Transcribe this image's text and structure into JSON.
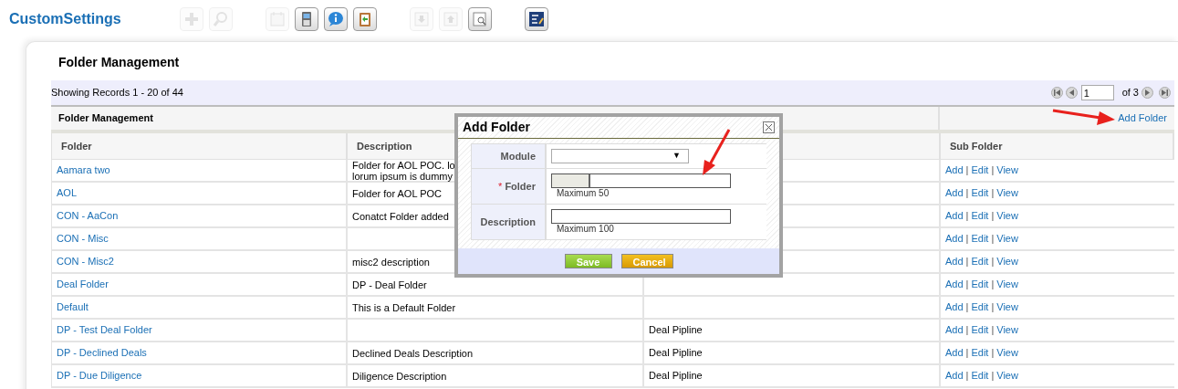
{
  "app_title": "CustomSettings",
  "toolbar": [
    {
      "items": [
        {
          "kind": "plus",
          "disabled": true
        },
        {
          "kind": "search",
          "disabled": true
        }
      ]
    },
    {
      "items": [
        {
          "kind": "calendar",
          "disabled": true
        },
        {
          "kind": "phone",
          "disabled": false
        },
        {
          "kind": "info",
          "disabled": false
        },
        {
          "kind": "clipboard",
          "disabled": false
        }
      ]
    },
    {
      "items": [
        {
          "kind": "down",
          "disabled": true
        },
        {
          "kind": "up",
          "disabled": true
        },
        {
          "kind": "preview",
          "disabled": false
        }
      ]
    },
    {
      "items": [
        {
          "kind": "report",
          "disabled": false
        }
      ]
    }
  ],
  "page_title": "Folder Management",
  "records_info": "Showing Records 1 - 20 of 44",
  "pager": {
    "page": "1",
    "of": "of 3"
  },
  "section": {
    "title": "Folder Management",
    "link": "Add Folder"
  },
  "table": {
    "columns": [
      "Folder",
      "Description",
      "",
      "Sub Folder"
    ],
    "separator": "|",
    "rows": [
      {
        "folder": "Aamara two",
        "description": [
          "Folder for AOL POC. lo",
          "lorum ipsum is dummy"
        ],
        "column_3": "",
        "actions": [
          "Add",
          "Edit",
          "View"
        ]
      },
      {
        "folder": "AOL",
        "description": [
          "Folder for AOL POC"
        ],
        "column_3": "",
        "actions": [
          "Add",
          "Edit",
          "View"
        ]
      },
      {
        "folder": "CON - AaCon",
        "description": [
          "Conatct Folder added"
        ],
        "column_3": "",
        "actions": [
          "Add",
          "Edit",
          "View"
        ]
      },
      {
        "folder": "CON - Misc",
        "description": [],
        "column_3": "",
        "actions": [
          "Add",
          "Edit",
          "View"
        ]
      },
      {
        "folder": "CON - Misc2",
        "description": [
          "misc2 description"
        ],
        "column_3": "",
        "actions": [
          "Add",
          "Edit",
          "View"
        ]
      },
      {
        "folder": "Deal Folder",
        "description": [
          "DP - Deal Folder"
        ],
        "column_3": "",
        "actions": [
          "Add",
          "Edit",
          "View"
        ]
      },
      {
        "folder": "Default",
        "description": [
          "This is a Default Folder"
        ],
        "column_3": "",
        "actions": [
          "Add",
          "Edit",
          "View"
        ]
      },
      {
        "folder": "DP - Test Deal Folder",
        "description": [],
        "column_3": "Deal Pipline",
        "actions": [
          "Add",
          "Edit",
          "View"
        ]
      },
      {
        "folder": "DP - Declined Deals",
        "description": [
          "Declined Deals Description"
        ],
        "column_3": "Deal Pipline",
        "actions": [
          "Add",
          "Edit",
          "View"
        ]
      },
      {
        "folder": "DP - Due Diligence",
        "description": [
          "Diligence Description"
        ],
        "column_3": "Deal Pipline",
        "actions": [
          "Add",
          "Edit",
          "View"
        ]
      }
    ]
  },
  "dialog": {
    "title": "Add Folder",
    "fields": [
      {
        "kind": "select",
        "label": "Module",
        "arrow": "▼"
      },
      {
        "kind": "text",
        "label": "Folder",
        "marker": "*",
        "hint": "Maximum 50"
      },
      {
        "kind": "text",
        "label": "Description",
        "hint": "Maximum 100"
      }
    ],
    "buttons": [
      {
        "kind": "primary",
        "label": "Save"
      },
      {
        "kind": "secondary",
        "label": "Cancel"
      }
    ]
  }
}
